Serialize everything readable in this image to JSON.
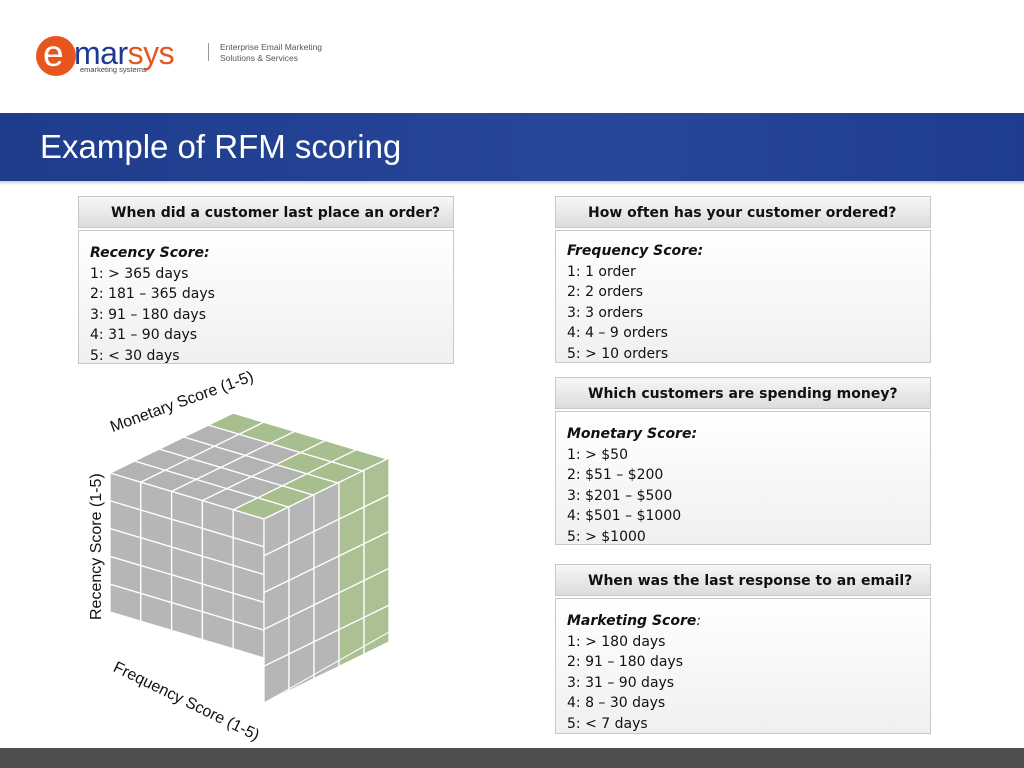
{
  "logo": {
    "mark_letter": "e",
    "word_part1": "mar",
    "word_part2": "sys",
    "subtitle": "emarketing systems",
    "tagline_line1": "Enterprise Email Marketing",
    "tagline_line2": "Solutions & Services"
  },
  "title": "Example of RFM scoring",
  "cards": [
    {
      "question": "When did a customer last place an order?",
      "score_title": "Recency Score:",
      "lines": [
        "1: > 365 days",
        "2: 181 – 365 days",
        "3: 91 – 180 days",
        "4: 31 – 90 days",
        "5: < 30 days"
      ]
    },
    {
      "question": "How often has your customer ordered?",
      "score_title": "Frequency Score:",
      "lines": [
        "1: 1 order",
        "2: 2 orders",
        "3: 3 orders",
        "4: 4 – 9 orders",
        "5: > 10 orders"
      ]
    },
    {
      "question": "Which customers are spending money?",
      "score_title": "Monetary Score:",
      "lines": [
        "1: > $50",
        "2: $51 – $200",
        "3: $201 – $500",
        "4: $501 – $1000",
        "5: > $1000"
      ]
    },
    {
      "question": "When was the last response to an email?",
      "score_title": "Marketing Score",
      "score_title_suffix": ":",
      "lines": [
        "1: > 180 days",
        "2: 91 – 180 days",
        "3: 31 – 90 days",
        "4: 8 – 30 days",
        "5: < 7 days"
      ]
    }
  ],
  "cube": {
    "top_axis_label": "Monetary Score (1-5)",
    "left_axis_label": "Recency Score (1-5)",
    "bottom_axis_label": "Frequency Score (1-5)",
    "grey_color": "#9a9a9a",
    "highlight_color": "#8aa86a"
  },
  "colors": {
    "brand_orange": "#e8561f",
    "brand_blue": "#1f3c8c",
    "footer": "#4e4e4e"
  }
}
